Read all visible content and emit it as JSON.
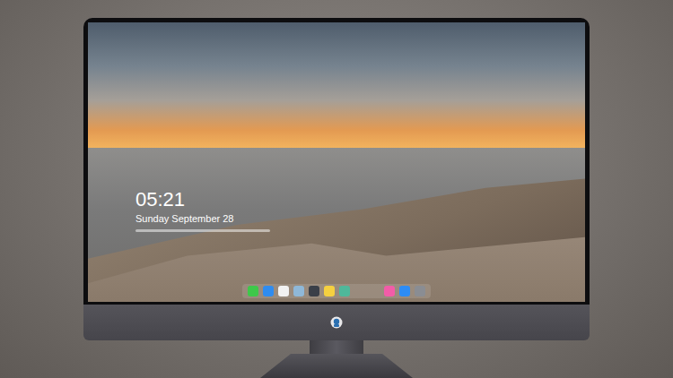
{
  "lock_screen": {
    "time": "05:21",
    "date": "Sunday September 28"
  },
  "dock": {
    "apps": [
      {
        "color": "#3ec84a"
      },
      {
        "color": "#2f8cf0"
      },
      {
        "color": "#f2f2f2"
      },
      {
        "color": "#8fb8d8"
      },
      {
        "color": "#3a3f48"
      },
      {
        "color": "#f5d040"
      },
      {
        "color": "#4fb89a"
      }
    ],
    "extras": [
      {
        "color": "#f25ca8"
      },
      {
        "color": "#2d8cf5"
      },
      {
        "color": "#8a8d93"
      }
    ]
  }
}
